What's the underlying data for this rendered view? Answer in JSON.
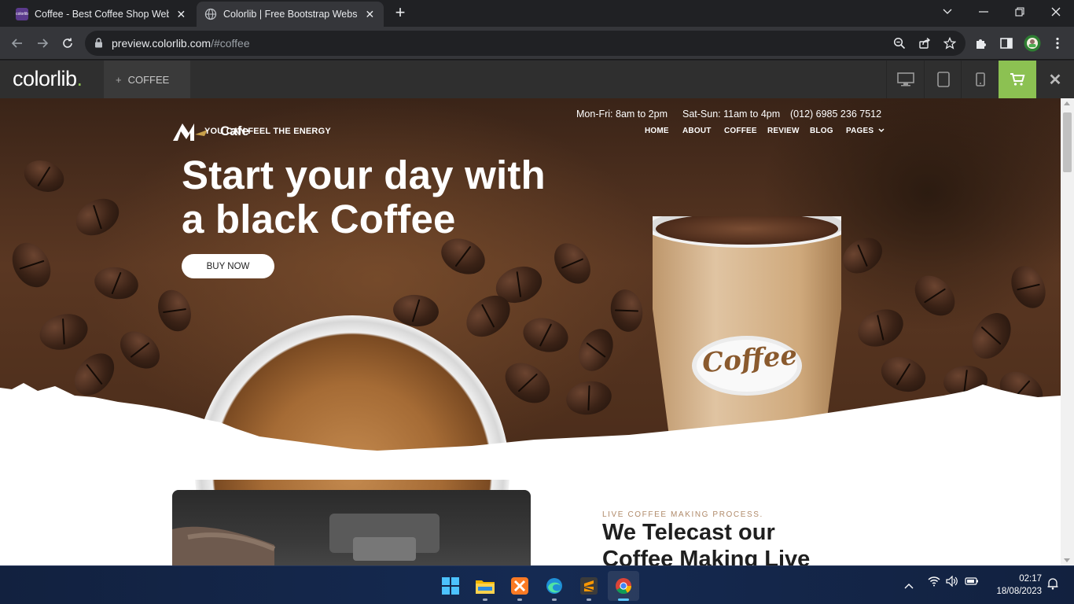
{
  "browser": {
    "tabs": [
      {
        "title": "Coffee - Best Coffee Shop Website",
        "favicon": "colorlib-favicon",
        "active": false
      },
      {
        "title": "Colorlib | Free Bootstrap Website",
        "favicon": "globe-icon",
        "active": true
      }
    ],
    "favicon_text": "colorlib",
    "url_host": "preview.colorlib.com",
    "url_path": "/#coffee"
  },
  "preview_bar": {
    "logo": "colorlib",
    "logo_dot": ".",
    "theme_plus": "+",
    "theme_label": "COFFEE",
    "accent": "#8cc152"
  },
  "site": {
    "brand_name": "Cafe",
    "tagline": "YOU CAN FEEL THE ENERGY",
    "hours": [
      "Mon-Fri: 8am to 2pm",
      "Sat-Sun: 11am to 4pm"
    ],
    "phone": "(012) 6985 236 7512",
    "nav": [
      "HOME",
      "ABOUT",
      "COFFEE",
      "REVIEW",
      "BLOG",
      "PAGES"
    ],
    "hero_title_line1": "Start your day with",
    "hero_title_line2": "a black Coffee",
    "buy_button": "BUY NOW",
    "cup_label": "Coffee",
    "section_eyebrow": "LIVE COFFEE MAKING PROCESS.",
    "section_title_line1": "We Telecast our",
    "section_title_line2": "Coffee Making Live"
  },
  "taskbar": {
    "apps": [
      "start-icon",
      "file-explorer-icon",
      "xampp-icon",
      "edge-icon",
      "sublime-text-icon",
      "chrome-icon"
    ],
    "time": "02:17",
    "date": "18/08/2023"
  }
}
